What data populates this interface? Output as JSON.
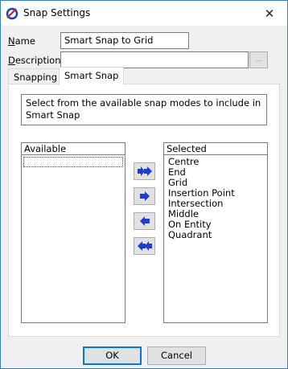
{
  "window": {
    "title": "Snap Settings"
  },
  "form": {
    "name_label_u": "N",
    "name_label_rest": "ame",
    "name_value": "Smart Snap to Grid",
    "description_label_u": "D",
    "description_label_rest": "escription",
    "description_value": "",
    "browse_label": "..."
  },
  "tabs": [
    {
      "label": "Snapping",
      "active": false
    },
    {
      "label": "Smart Snap",
      "active": true
    }
  ],
  "smart_snap": {
    "instructions": "Select from the available snap modes to include in Smart Snap",
    "available_header": "Available",
    "available_items": [],
    "selected_header": "Selected",
    "selected_items": [
      "Centre",
      "End",
      "Grid",
      "Insertion Point",
      "Intersection",
      "Middle",
      "On Entity",
      "Quadrant"
    ]
  },
  "buttons": {
    "ok": "OK",
    "cancel": "Cancel"
  },
  "colors": {
    "arrow_blue": "#1e3ccd",
    "accent": "#0078d7"
  }
}
